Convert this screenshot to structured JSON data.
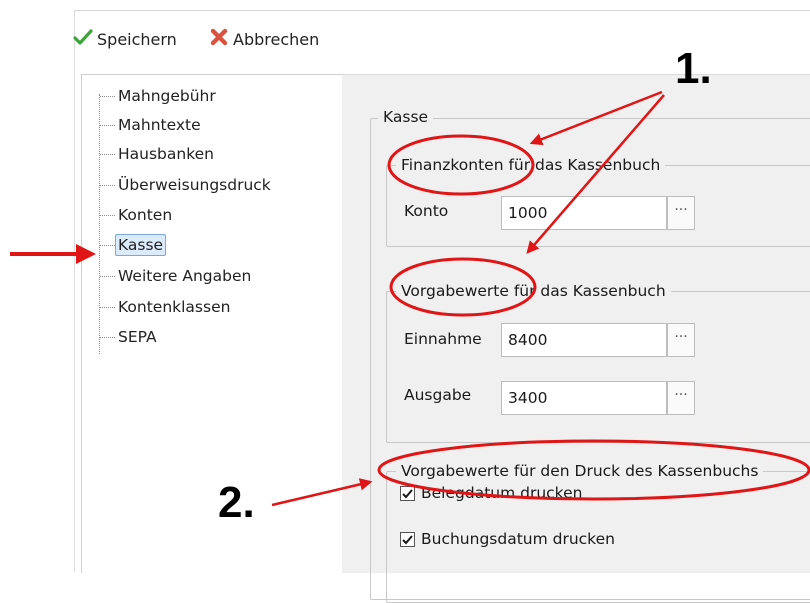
{
  "toolbar": {
    "save_label": "Speichern",
    "cancel_label": "Abbrechen"
  },
  "tree": {
    "items": [
      {
        "label": "Mahngebühr"
      },
      {
        "label": "Mahntexte"
      },
      {
        "label": "Hausbanken"
      },
      {
        "label": "Überweisungsdruck"
      },
      {
        "label": "Konten"
      },
      {
        "label": "Kasse",
        "selected": true
      },
      {
        "label": "Weitere Angaben"
      },
      {
        "label": "Kontenklassen"
      },
      {
        "label": "SEPA"
      }
    ]
  },
  "kasse": {
    "title": "Kasse",
    "finanz": {
      "title": "Finanzkonten für das Kassenbuch",
      "konto_label": "Konto",
      "konto_value": "1000"
    },
    "vorgabe": {
      "title": "Vorgabewerte für das Kassenbuch",
      "einnahme_label": "Einnahme",
      "einnahme_value": "8400",
      "ausgabe_label": "Ausgabe",
      "ausgabe_value": "3400"
    },
    "druck": {
      "title": "Vorgabewerte für den Druck des Kassenbuchs",
      "belegdatum": {
        "label": "Belegdatum drucken",
        "checked": true
      },
      "buchungsdatum": {
        "label": "Buchungsdatum drucken",
        "checked": true
      }
    }
  },
  "annotations": {
    "one": "1.",
    "two": "2.",
    "color": "#e01515"
  },
  "lookup_button_glyph": "...",
  "colors": {
    "accent_check": "#3aa63a",
    "cancel_x": "#d9533f",
    "selection": "#dcebfb"
  }
}
